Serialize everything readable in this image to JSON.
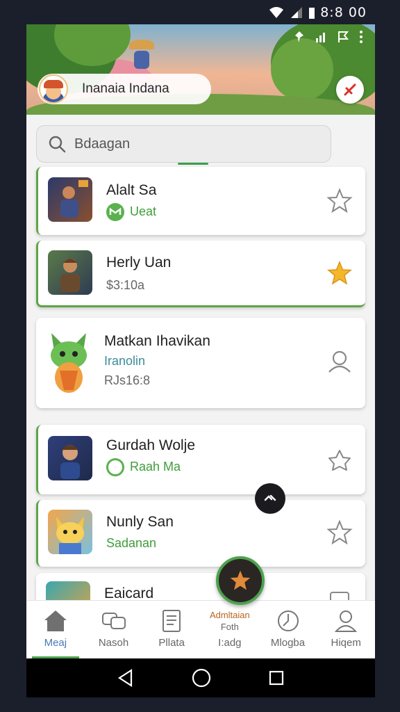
{
  "status_bar": {
    "time": "8:8 00"
  },
  "header": {
    "profile_name": "Inanaia Indana"
  },
  "search": {
    "text": "Bdaagan"
  },
  "list": [
    {
      "title": "Alalt Sa",
      "subtitle": "Ueat",
      "right_icon": "star-outline-icon"
    },
    {
      "title": "Herly Uan",
      "subtitle": "$3:10a",
      "right_icon": "star-filled-icon"
    },
    {
      "title": "Matkan Ihavikan",
      "subtitle": "Iranolin",
      "detail": "RJs16:8",
      "right_icon": "person-icon"
    },
    {
      "title": "Gurdah Wolje",
      "subtitle": "Raah Ma",
      "right_icon": "star-outline-icon"
    },
    {
      "title": "Nunly San",
      "subtitle": "Sadanan",
      "right_icon": "star-outline-icon"
    },
    {
      "title": "Eaicard",
      "subtitle": "",
      "right_icon": "calendar-icon"
    }
  ],
  "bottom_nav": [
    {
      "label": "Meaj",
      "icon": "home-icon"
    },
    {
      "label": "Nasoh",
      "icon": "chat-icon"
    },
    {
      "label": "Pllata",
      "icon": "document-icon"
    },
    {
      "label": "I:adg",
      "top": "Admltaian",
      "mid": "Foth",
      "icon": "star-fab-icon"
    },
    {
      "label": "Mlogba",
      "icon": "compass-icon"
    },
    {
      "label": "Hiqem",
      "icon": "profile-icon"
    }
  ],
  "colors": {
    "accent_green": "#4da24d",
    "star_gold": "#f5b72a",
    "active_blue": "#4a78b8"
  }
}
